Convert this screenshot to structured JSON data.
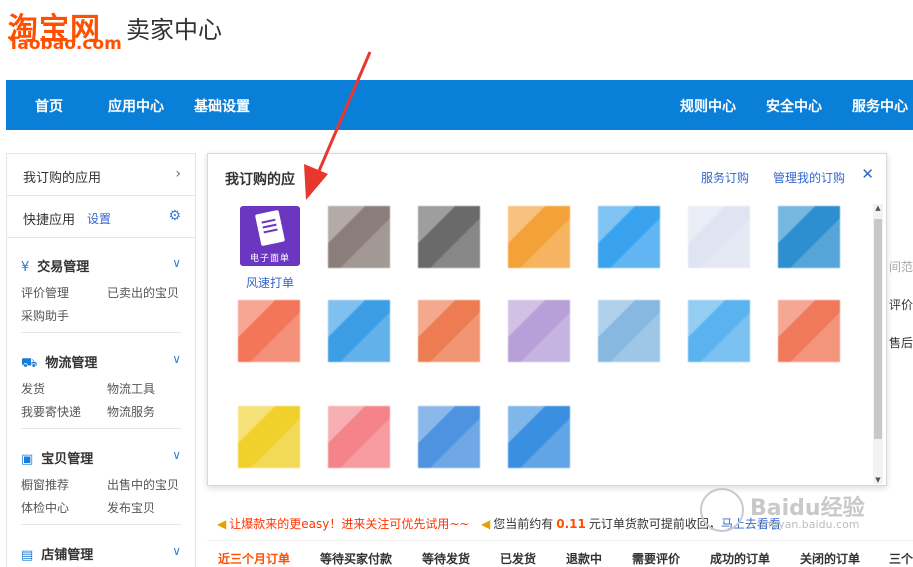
{
  "header": {
    "logo_cn": "淘宝网",
    "logo_en": "Taobao.com",
    "title": "卖家中心"
  },
  "topnav": {
    "left": [
      "首页",
      "应用中心",
      "基础设置"
    ],
    "right": [
      "规则中心",
      "安全中心",
      "服务中心"
    ]
  },
  "sidebar": {
    "subscribed": "我订购的应用",
    "quick_apps": "快捷应用",
    "settings": "设置",
    "sections": [
      {
        "title": "交易管理",
        "links": [
          "评价管理",
          "已卖出的宝贝",
          "采购助手"
        ]
      },
      {
        "title": "物流管理",
        "links": [
          "发货",
          "物流工具",
          "我要寄快递",
          "物流服务"
        ]
      },
      {
        "title": "宝贝管理",
        "links": [
          "橱窗推荐",
          "出售中的宝贝",
          "体检中心",
          "发布宝贝"
        ]
      },
      {
        "title": "店铺管理",
        "links": []
      }
    ]
  },
  "popup": {
    "title": "我订购的应",
    "service_order": "服务订购",
    "manage_orders": "管理我的订购",
    "close": "✕",
    "first_app": {
      "icon_label": "电子面单",
      "name": "风速打单"
    },
    "tile_colors": [
      [
        "#8b7e7a",
        "#6a6a6a",
        "#f4a13a",
        "#3aa3ef",
        "#dfe4f2",
        "#2d8fcf"
      ],
      [
        "#f3765a",
        "#3c9ee5",
        "#ee7c52",
        "#b7a0d8",
        "#86b8e0",
        "#5ab2ee",
        "#f0795b"
      ],
      [
        "#f0d12c",
        "#f4848a",
        "#4d93e0",
        "#3b8fe0"
      ]
    ]
  },
  "behind": {
    "frag1": "间范",
    "frag2": "评价化",
    "frag3": "售后服"
  },
  "notices": {
    "left": "让爆款来的更easy！进来关注可优先试用~~",
    "right_pre": "您当前约有",
    "right_num": "0.11",
    "right_post": "元订单货款可提前收回，",
    "right_link": "马上去看看"
  },
  "tabs": [
    "近三个月订单",
    "等待买家付款",
    "等待发货",
    "已发货",
    "退款中",
    "需要评价",
    "成功的订单",
    "关闭的订单",
    "三个"
  ],
  "watermark": {
    "text": "Baidu经验",
    "sub": "jingyan.baidu.com"
  },
  "colors": {
    "brand": "#ff5000",
    "nav": "#0a7fd8",
    "link": "#3366cc",
    "app_icon": "#6b37c0"
  }
}
